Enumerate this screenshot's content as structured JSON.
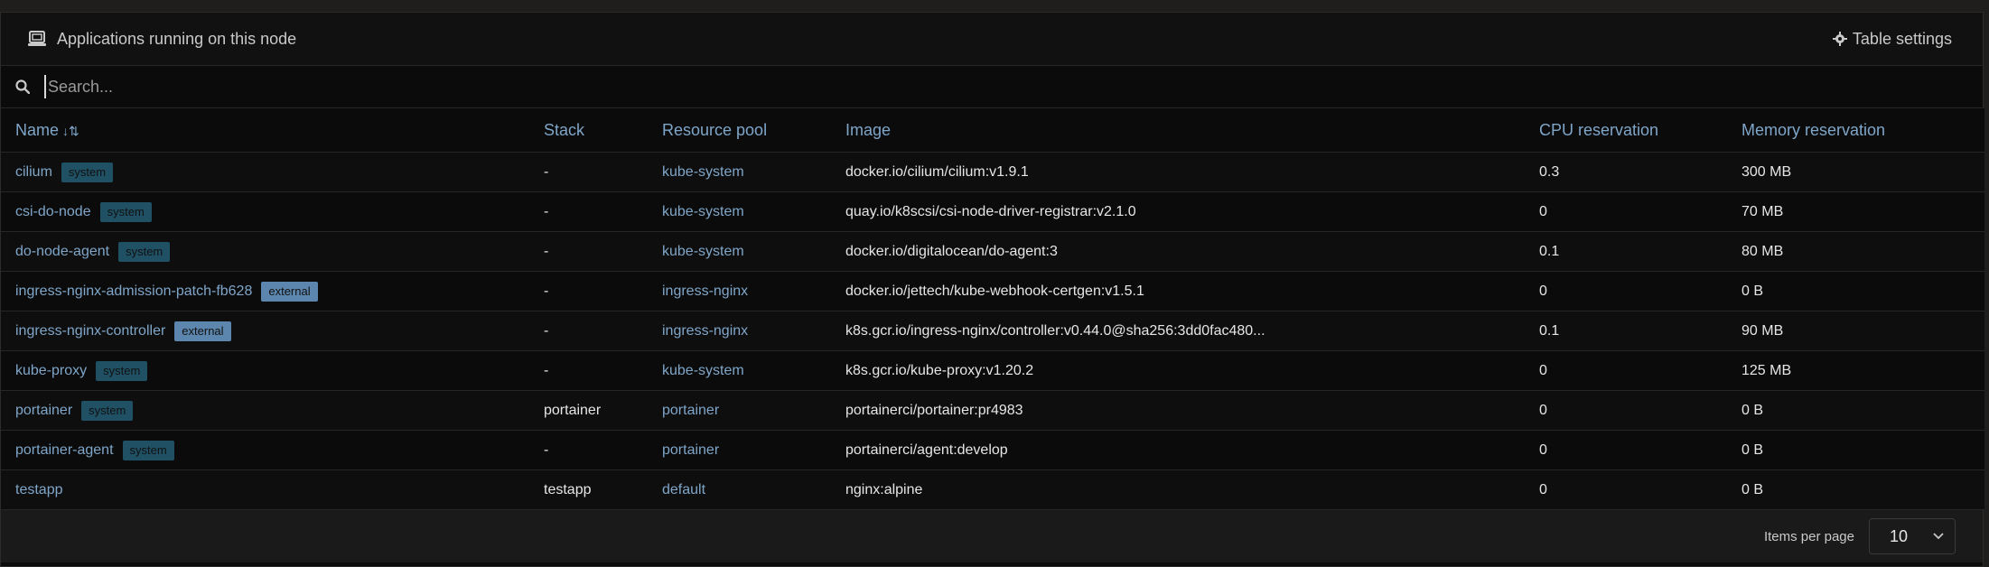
{
  "header": {
    "title": "Applications running on this node",
    "settings_label": "Table settings"
  },
  "search": {
    "placeholder": "Search..."
  },
  "table": {
    "columns": [
      "Name",
      "Stack",
      "Resource pool",
      "Image",
      "CPU reservation",
      "Memory reservation"
    ],
    "rows": [
      {
        "name": "cilium",
        "badge": "system",
        "stack": "-",
        "pool": "kube-system",
        "image": "docker.io/cilium/cilium:v1.9.1",
        "cpu": "0.3",
        "memory": "300 MB"
      },
      {
        "name": "csi-do-node",
        "badge": "system",
        "stack": "-",
        "pool": "kube-system",
        "image": "quay.io/k8scsi/csi-node-driver-registrar:v2.1.0",
        "cpu": "0",
        "memory": "70 MB"
      },
      {
        "name": "do-node-agent",
        "badge": "system",
        "stack": "-",
        "pool": "kube-system",
        "image": "docker.io/digitalocean/do-agent:3",
        "cpu": "0.1",
        "memory": "80 MB"
      },
      {
        "name": "ingress-nginx-admission-patch-fb628",
        "badge": "external",
        "stack": "-",
        "pool": "ingress-nginx",
        "image": "docker.io/jettech/kube-webhook-certgen:v1.5.1",
        "cpu": "0",
        "memory": "0 B"
      },
      {
        "name": "ingress-nginx-controller",
        "badge": "external",
        "stack": "-",
        "pool": "ingress-nginx",
        "image": "k8s.gcr.io/ingress-nginx/controller:v0.44.0@sha256:3dd0fac480...",
        "cpu": "0.1",
        "memory": "90 MB"
      },
      {
        "name": "kube-proxy",
        "badge": "system",
        "stack": "-",
        "pool": "kube-system",
        "image": "k8s.gcr.io/kube-proxy:v1.20.2",
        "cpu": "0",
        "memory": "125 MB"
      },
      {
        "name": "portainer",
        "badge": "system",
        "stack": "portainer",
        "pool": "portainer",
        "image": "portainerci/portainer:pr4983",
        "cpu": "0",
        "memory": "0 B"
      },
      {
        "name": "portainer-agent",
        "badge": "system",
        "stack": "-",
        "pool": "portainer",
        "image": "portainerci/agent:develop",
        "cpu": "0",
        "memory": "0 B"
      },
      {
        "name": "testapp",
        "badge": "",
        "stack": "testapp",
        "pool": "default",
        "image": "nginx:alpine",
        "cpu": "0",
        "memory": "0 B"
      }
    ]
  },
  "footer": {
    "items_per_page_label": "Items per page",
    "items_per_page_value": "10"
  },
  "icons": {
    "header": "laptop-icon",
    "settings": "gear-icon",
    "search": "search-icon",
    "sort": "sort-alpha-down-icon",
    "select": "chevron-down-icon"
  }
}
